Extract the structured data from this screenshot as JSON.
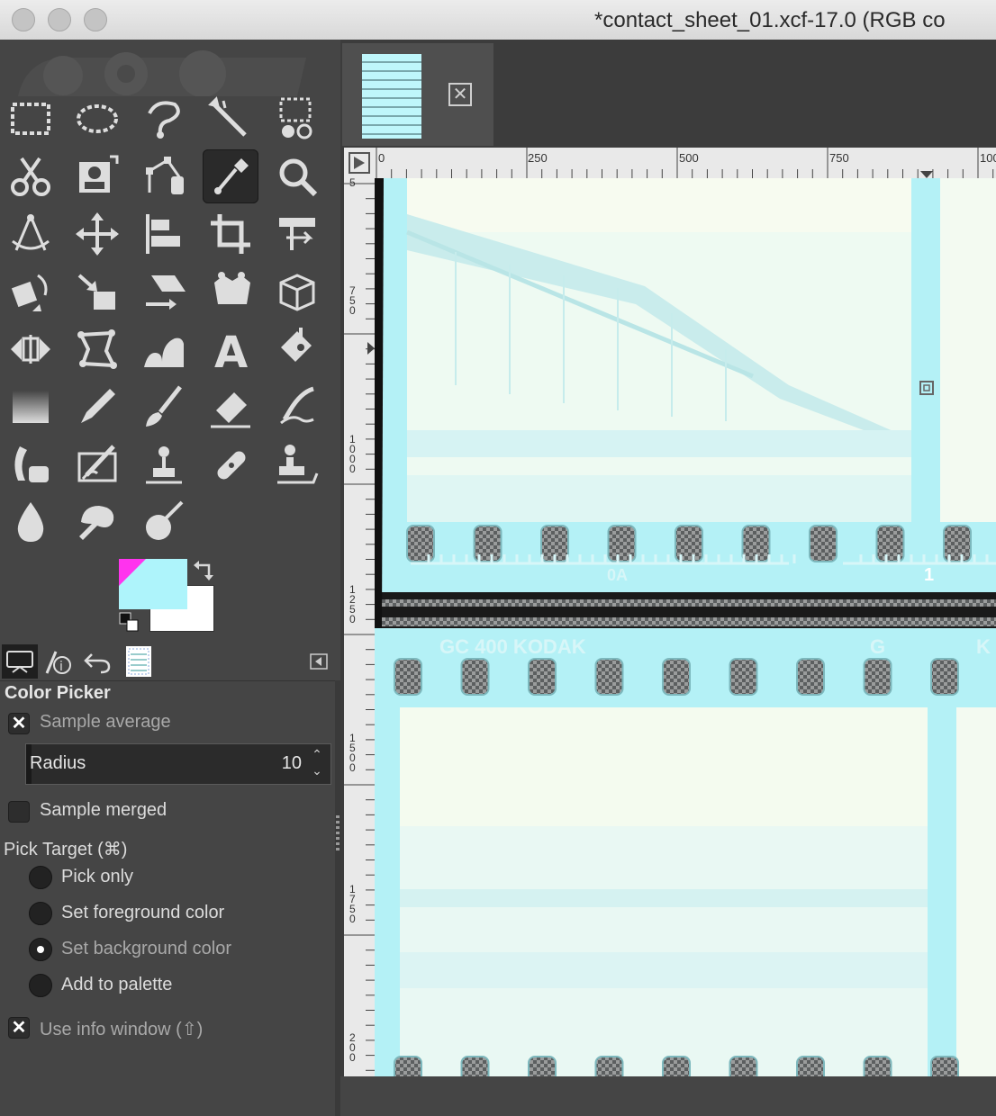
{
  "window": {
    "title": "*contact_sheet_01.xcf-17.0 (RGB co"
  },
  "colors": {
    "foreground": "#aef4fb",
    "background": "#ffffff",
    "accent_triangle": "#ff33ee",
    "film_cyan": "#aef4fb"
  },
  "toolbox": {
    "tools": [
      "rect-select-icon",
      "ellipse-select-icon",
      "free-select-icon",
      "fuzzy-select-icon",
      "select-by-color-icon",
      "scissors-select-icon",
      "foreground-select-icon",
      "paths-icon",
      "color-picker-icon",
      "zoom-icon",
      "measure-icon",
      "move-icon",
      "align-icon",
      "crop-icon",
      "unified-transform-icon",
      "rotate-icon",
      "scale-icon",
      "shear-icon",
      "perspective-icon",
      "3d-transform-icon",
      "flip-icon",
      "cage-icon",
      "warp-icon",
      "text-icon",
      "bucket-fill-icon",
      "gradient-icon",
      "pencil-icon",
      "paintbrush-icon",
      "eraser-icon",
      "airbrush-icon",
      "ink-icon",
      "mypaint-brush-icon",
      "clone-icon",
      "heal-icon",
      "perspective-clone-icon",
      "blur-icon",
      "smudge-icon",
      "dodge-burn-icon"
    ],
    "active_tool": "color-picker-icon"
  },
  "tool_options": {
    "title": "Color Picker",
    "sample_average": {
      "label": "Sample average",
      "checked": true
    },
    "radius": {
      "label": "Radius",
      "value": "10"
    },
    "sample_merged": {
      "label": "Sample merged",
      "checked": false
    },
    "pick_target": {
      "label": "Pick Target  (⌘)",
      "options": [
        "Pick only",
        "Set foreground color",
        "Set background color",
        "Add to palette"
      ],
      "selected": "Set background color"
    },
    "use_info_window": {
      "label": "Use info window  (⇧)",
      "checked": true
    }
  },
  "rulers": {
    "top": [
      "0",
      "250",
      "500",
      "750",
      "100"
    ],
    "left": [
      "5",
      "750",
      "1000",
      "1250",
      "1500",
      "1750",
      "200"
    ]
  },
  "film_text": {
    "edge_code_1": "GC 400  KODAK",
    "edge_code_2": "G",
    "edge_code_3": "K",
    "frame_number_1": "0A",
    "frame_number_2": "1"
  }
}
